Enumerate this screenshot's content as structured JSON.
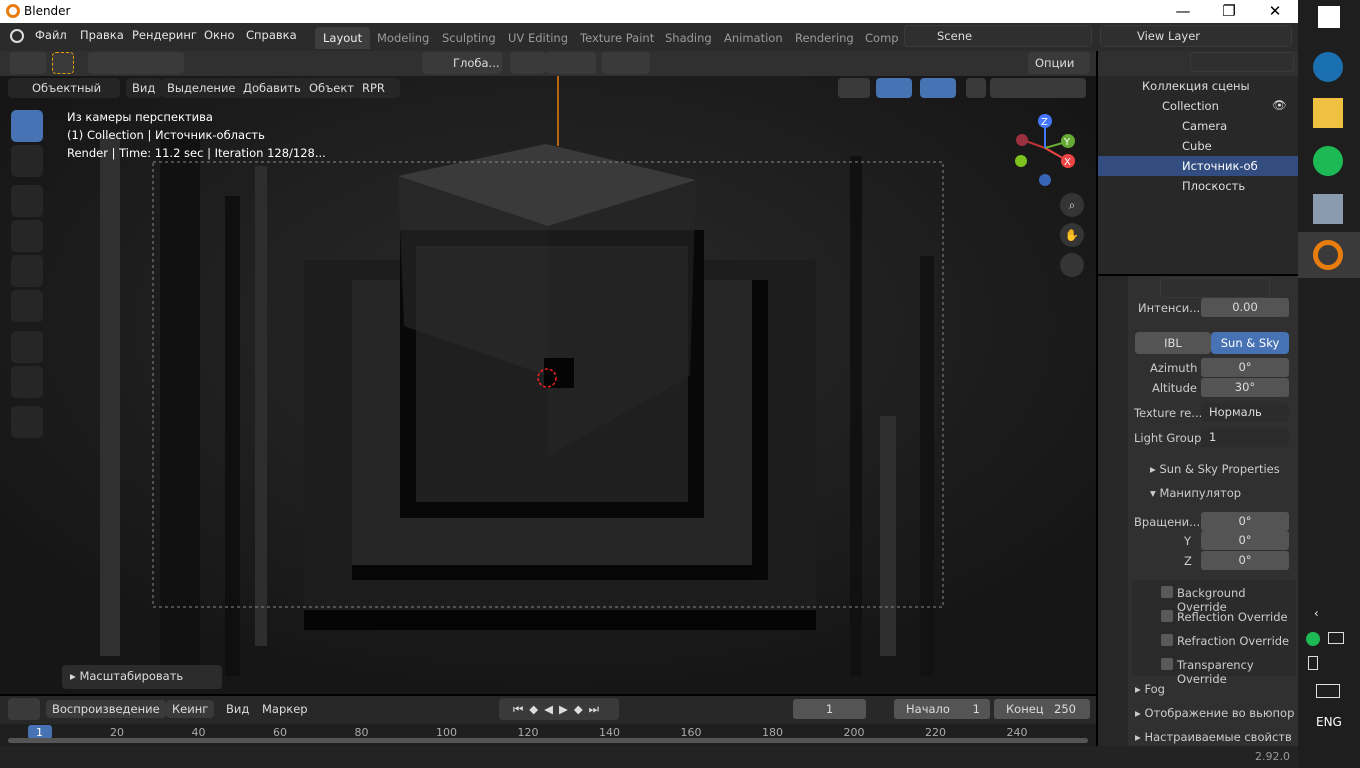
{
  "window": {
    "title": "Blender",
    "minimize": "—",
    "maximize": "❐",
    "close": "✕"
  },
  "menu": {
    "items": [
      "Файл",
      "Правка",
      "Рендеринг",
      "Окно",
      "Справка"
    ]
  },
  "workspaces": [
    "Layout",
    "Modeling",
    "Sculpting",
    "UV Editing",
    "Texture Paint",
    "Shading",
    "Animation",
    "Rendering",
    "Comp"
  ],
  "scene": {
    "name": "Scene",
    "view_layer": "View Layer"
  },
  "toolbar": {
    "orientation": "Глоба...",
    "options": "Опции"
  },
  "viewport_header": {
    "mode": "Объектный ...",
    "view": "Вид",
    "select": "Выделение",
    "add": "Добавить",
    "object": "Объект",
    "engine": "RPR"
  },
  "viewport_info": {
    "line1": "Из камеры перспектива",
    "line2": "(1) Collection | Источник-область",
    "line3": "Render | Time: 11.2 sec | Iteration 128/128..."
  },
  "gizmo": {
    "x": "X",
    "y": "Y",
    "z": "Z"
  },
  "last_op": "Масштабировать",
  "outliner": {
    "root": "Коллекция сцены",
    "collection": "Collection",
    "objects": [
      "Camera",
      "Cube",
      "Источник-об",
      "Плоскость"
    ]
  },
  "props": {
    "intensity_label": "Интенси...",
    "intensity_val": "0.00",
    "tab_ibl": "IBL",
    "tab_sunsky": "Sun & Sky",
    "azimuth_label": "Azimuth",
    "azimuth_val": "0°",
    "altitude_label": "Altitude",
    "altitude_val": "30°",
    "texres_label": "Texture re...",
    "texres_val": "Нормаль",
    "lightgroup_label": "Light Group",
    "lightgroup_val": "1",
    "sunsky_props": "Sun & Sky Properties",
    "manip": "Манипулятор",
    "rot_label": "Вращени...",
    "rot_x": "0°",
    "y_label": "Y",
    "rot_y": "0°",
    "z_label": "Z",
    "rot_z": "0°",
    "overrides": [
      "Background Override",
      "Reflection Override",
      "Refraction Override",
      "Transparency Override"
    ],
    "fog": "Fog",
    "viewport_disp": "Отображение во вьюпор",
    "custom_props": "Настраиваемые свойств"
  },
  "timeline": {
    "playback": "Воспроизведение",
    "keying": "Кеинг",
    "view": "Вид",
    "marker": "Маркер",
    "current": "1",
    "start_label": "Начало",
    "start": "1",
    "end_label": "Конец",
    "end": "250",
    "ticks": [
      "1",
      "20",
      "40",
      "60",
      "80",
      "100",
      "120",
      "140",
      "160",
      "180",
      "200",
      "220",
      "240"
    ]
  },
  "status": {
    "version": "2.92.0"
  },
  "taskbar": {
    "lang": "ENG"
  },
  "colors": {
    "accent": "#4772b3",
    "selected_row": "#334d80",
    "orange": "#e87d0d"
  }
}
